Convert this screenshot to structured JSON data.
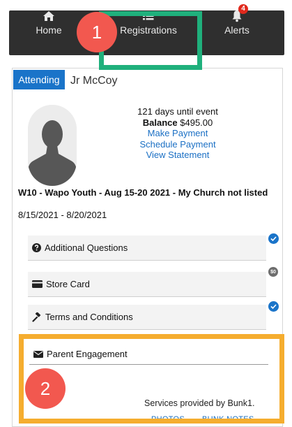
{
  "nav": {
    "home_label": "Home",
    "registrations_label": "Registrations",
    "alerts_label": "Alerts",
    "alerts_badge": "4",
    "icons": [
      "home-icon",
      "list-icon",
      "bell-icon"
    ]
  },
  "callouts": {
    "one": "1",
    "two": "2"
  },
  "registration": {
    "tab_label": "Attending",
    "camper_name": "Jr McCoy",
    "days_until": "121 days until event",
    "balance_label": "Balance",
    "balance_value": "$495.00",
    "make_payment": "Make Payment",
    "schedule_payment": "Schedule Payment",
    "view_statement": "View Statement",
    "event_title": "W10 - Wapo Youth - Aug 15-20 2021 - My Church not listed",
    "event_dates": "8/15/2021 - 8/20/2021"
  },
  "sections": {
    "additional_questions": "Additional Questions",
    "store_card": "Store Card",
    "store_card_badge": "$0",
    "terms": "Terms and Conditions"
  },
  "parent_engagement": {
    "title": "Parent Engagement",
    "provider_text": "Services provided by Bunk1.",
    "photos": "PHOTOS",
    "bunk_notes": "BUNK NOTES"
  },
  "colors": {
    "nav_bg": "#2f2f2f",
    "accent_blue": "#1a74c9",
    "highlight_green": "#1fb07c",
    "highlight_orange": "#f5ad2f",
    "callout_red": "#f2584f"
  }
}
